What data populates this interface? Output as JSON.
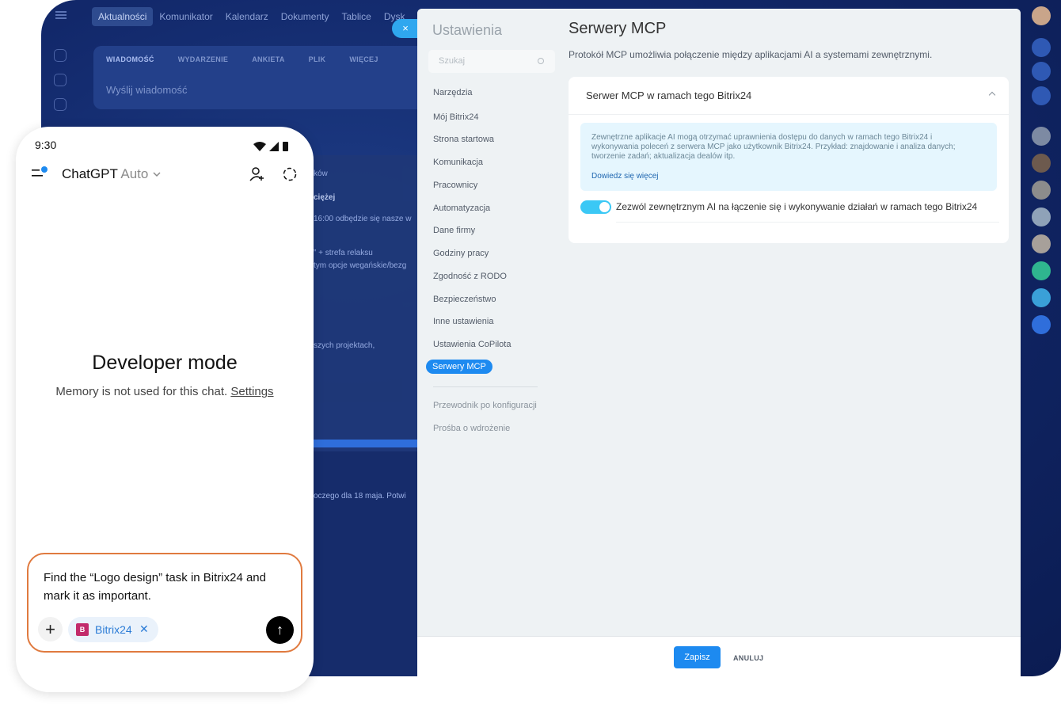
{
  "bitrix": {
    "nav": [
      "Aktualności",
      "Komunikator",
      "Kalendarz",
      "Dokumenty",
      "Tablice",
      "Dysk"
    ],
    "composer_tabs": [
      "WIADOMOŚĆ",
      "WYDARZENIE",
      "ANKIETA",
      "PLIK",
      "WIĘCEJ"
    ],
    "composer_placeholder": "Wyślij wiadomość",
    "feed_snippets": [
      "ków",
      "ciężej",
      "16:00 odbędzie się nasze w",
      "” + strefa relaksu",
      "tym opcje wegańskie/bezg",
      "szych projektach,",
      "oczego dla 18 maja. Potwi"
    ],
    "close_icon": "×"
  },
  "settings": {
    "title": "Ustawienia",
    "search_placeholder": "Szukaj",
    "menu": [
      "Narzędzia",
      "Mój Bitrix24",
      "Strona startowa",
      "Komunikacja",
      "Pracownicy",
      "Automatyzacja",
      "Dane firmy",
      "Godziny pracy",
      "Zgodność z RODO",
      "Bezpieczeństwo",
      "Inne ustawienia",
      "Ustawienia CoPilota",
      "Serwery MCP"
    ],
    "selected": "Serwery MCP",
    "extra": [
      "Przewodnik po konfiguracji",
      "Prośba o wdrożenie"
    ]
  },
  "content": {
    "title": "Serwery MCP",
    "description": "Protokół MCP umożliwia połączenie między aplikacjami AI a systemami zewnętrznymi.",
    "section_title": "Serwer MCP w ramach tego Bitrix24",
    "info": "Zewnętrzne aplikacje AI mogą otrzymać uprawnienia dostępu do danych w ramach tego Bitrix24 i wykonywania poleceń z serwera MCP jako użytkownik Bitrix24. Przykład: znajdowanie i analiza danych; tworzenie zadań; aktualizacja dealów itp.",
    "learn_more": "Dowiedz się więcej",
    "toggle_label": "Zezwól zewnętrznym AI na łączenie się i wykonywanie działań w ramach tego Bitrix24",
    "toggle_on": true,
    "save": "Zapisz",
    "cancel": "ANULUJ"
  },
  "phone": {
    "time": "9:30",
    "app": "ChatGPT",
    "model": "Auto",
    "mode_title": "Developer mode",
    "memory_note": "Memory is not used for this chat.",
    "settings_link": "Settings",
    "prompt": "Find the “Logo design” task in Bitrix24 and mark it as important.",
    "chip": "Bitrix24",
    "chip_logo": "B"
  },
  "colors": {
    "accent": "#1d8af0",
    "toggle": "#3bc8f5",
    "input_border": "#e07a3f",
    "brand_logo": "#c22b6b"
  }
}
